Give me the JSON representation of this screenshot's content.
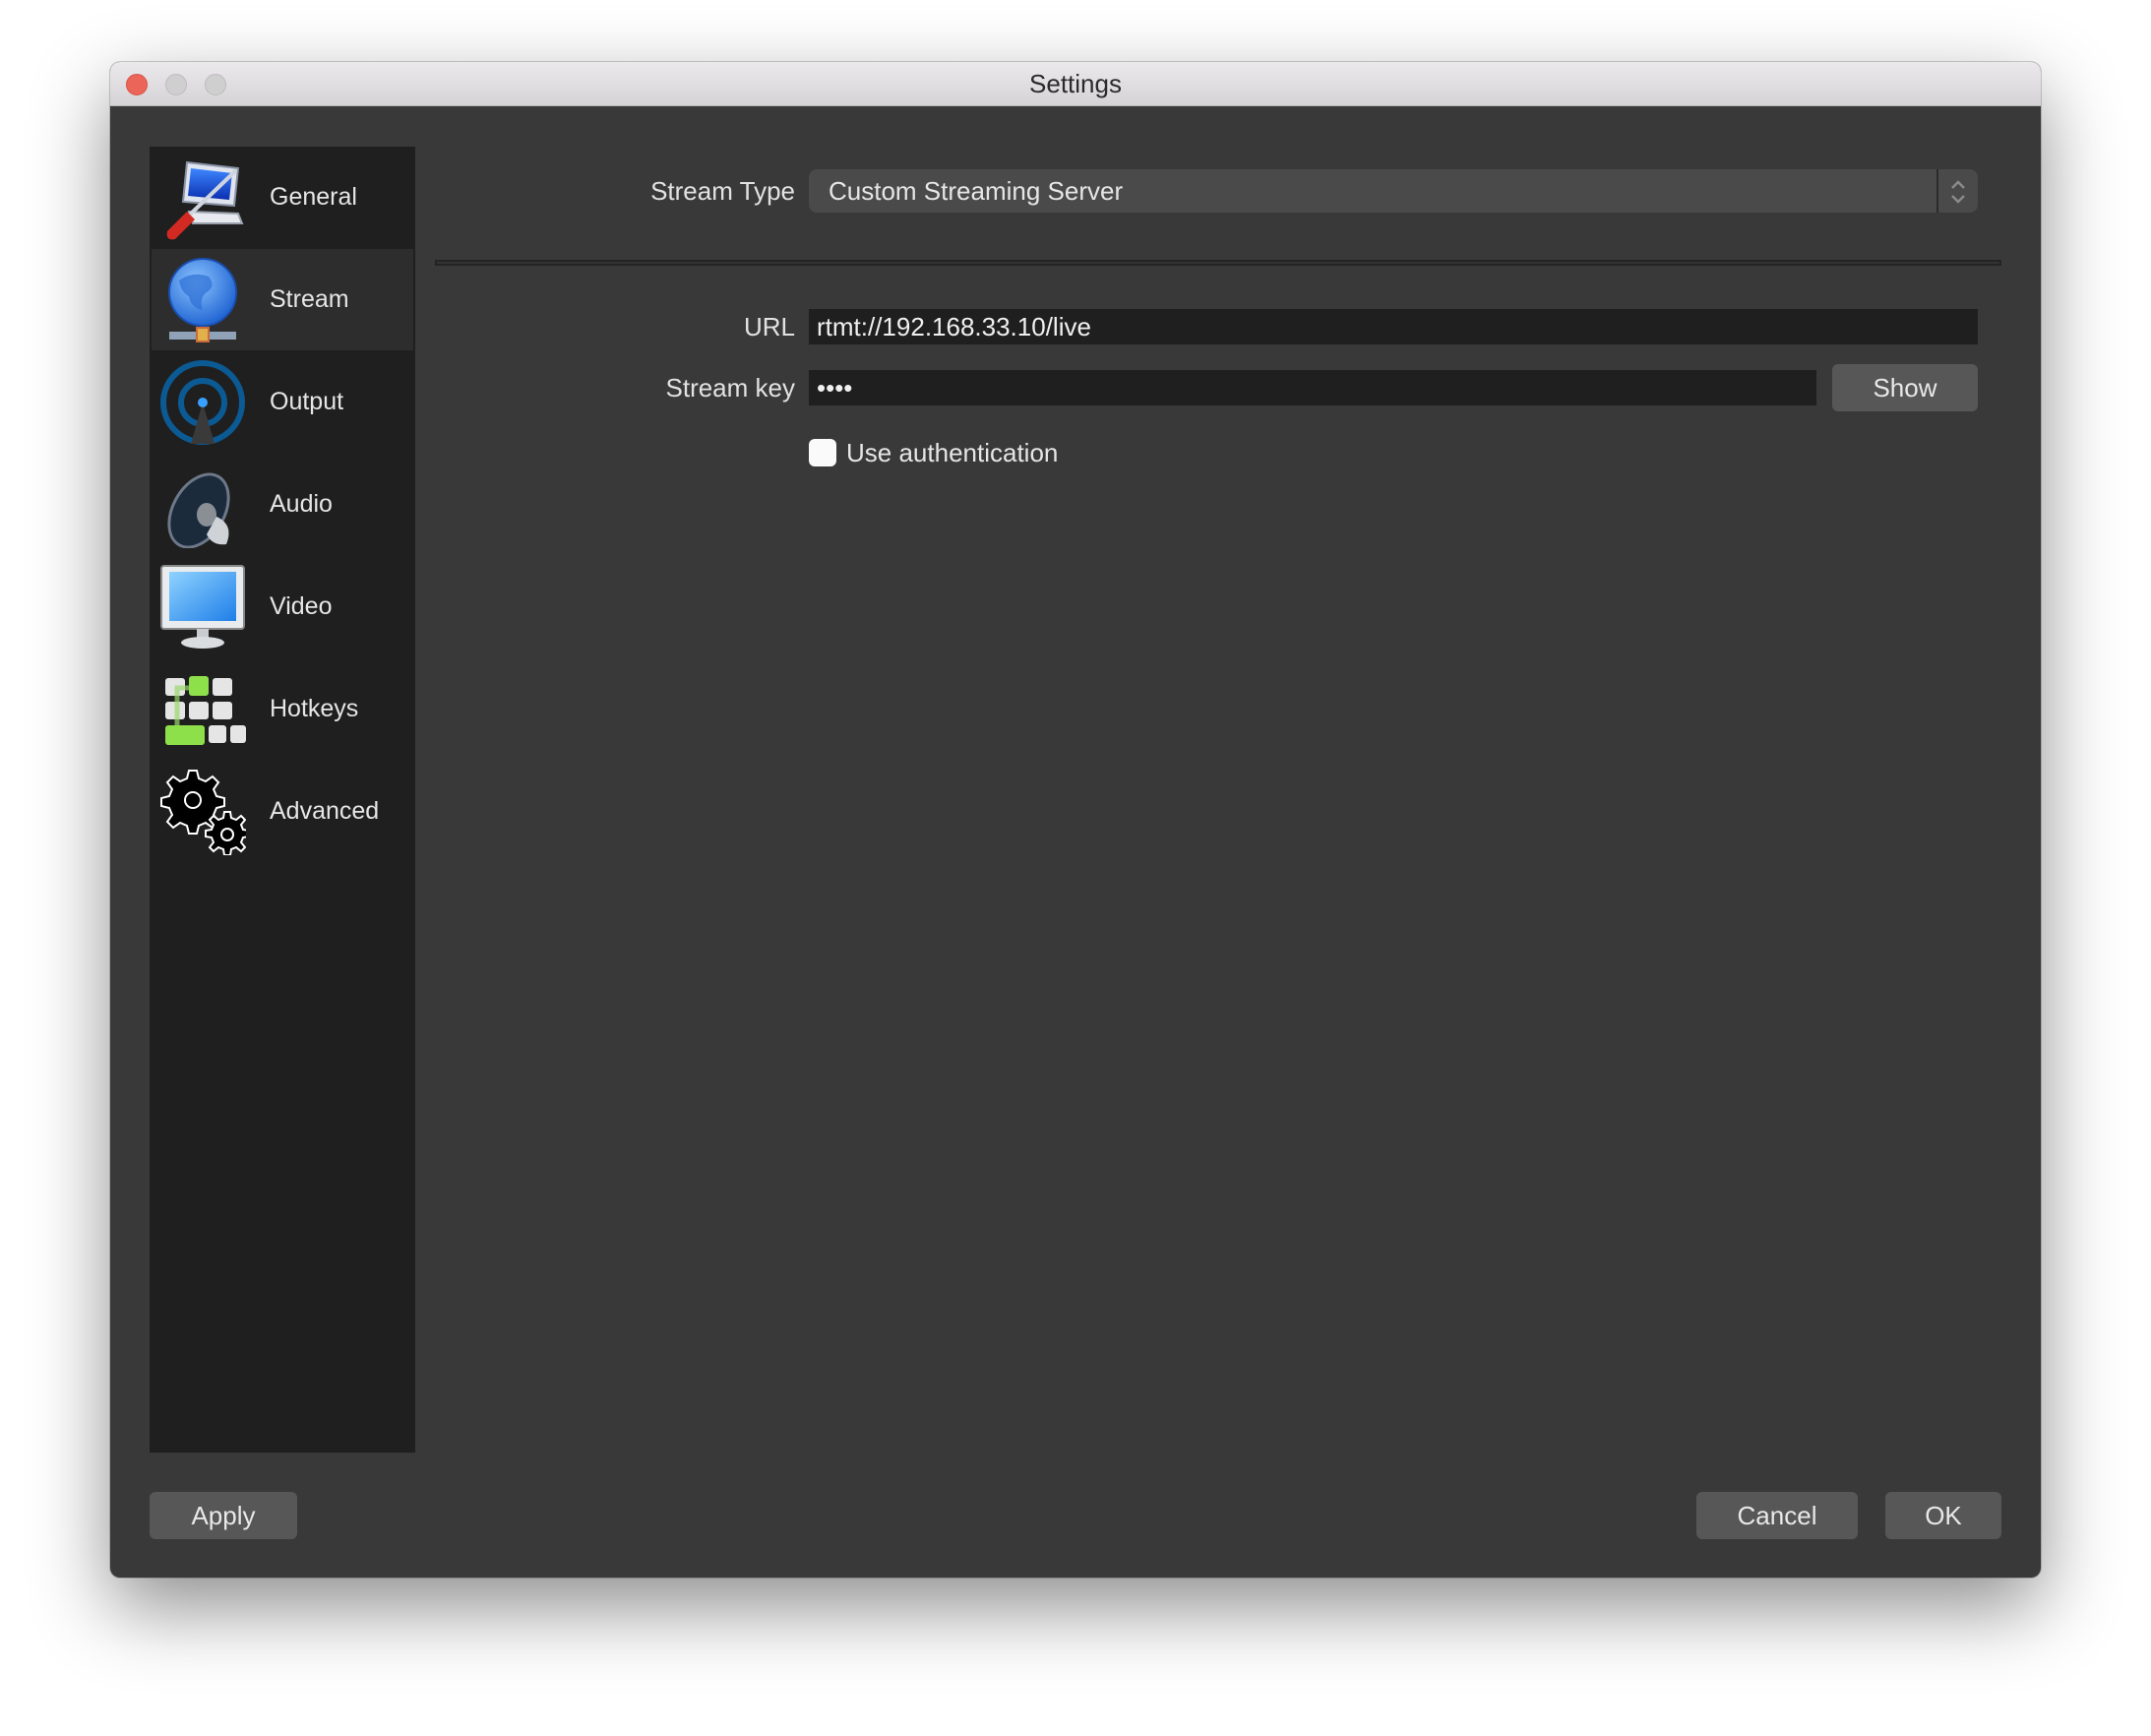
{
  "window": {
    "title": "Settings",
    "controls": [
      "close",
      "minimize",
      "maximize"
    ]
  },
  "sidebar": {
    "items": [
      {
        "label": "General",
        "icon": "general-monitor-screwdriver-icon",
        "selected": false
      },
      {
        "label": "Stream",
        "icon": "globe-network-icon",
        "selected": true
      },
      {
        "label": "Output",
        "icon": "broadcast-antenna-icon",
        "selected": false
      },
      {
        "label": "Audio",
        "icon": "speaker-icon",
        "selected": false
      },
      {
        "label": "Video",
        "icon": "monitor-icon",
        "selected": false
      },
      {
        "label": "Hotkeys",
        "icon": "keyboard-keys-icon",
        "selected": false
      },
      {
        "label": "Advanced",
        "icon": "gears-icon",
        "selected": false
      }
    ]
  },
  "stream": {
    "stream_type_label": "Stream Type",
    "stream_type_value": "Custom Streaming Server",
    "url_label": "URL",
    "url_value": "rtmt://192.168.33.10/live",
    "stream_key_label": "Stream key",
    "stream_key_value": "••••",
    "show_button": "Show",
    "use_auth_label": "Use authentication",
    "use_auth_checked": false
  },
  "footer": {
    "apply": "Apply",
    "cancel": "Cancel",
    "ok": "OK"
  }
}
